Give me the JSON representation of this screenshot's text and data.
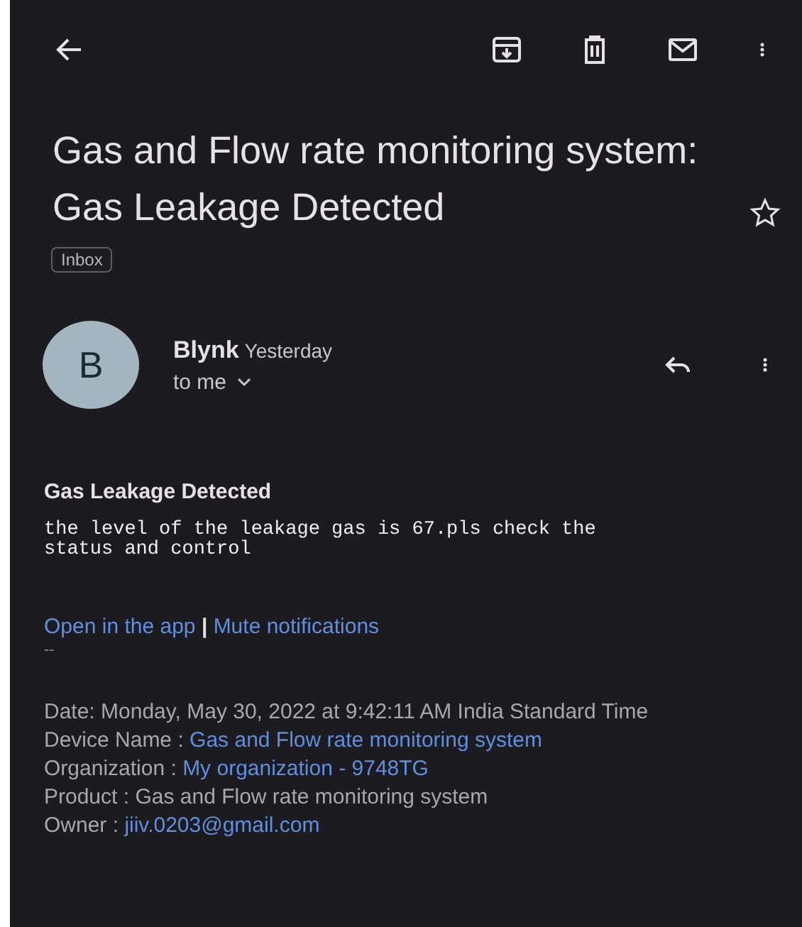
{
  "subject": "Gas and Flow rate monitoring system: Gas Leakage Detected",
  "starred": false,
  "label": "Inbox",
  "sender": {
    "initial": "B",
    "name": "Blynk",
    "time": "Yesterday",
    "recipient": "to me"
  },
  "heading": "Gas Leakage Detected",
  "body": "the level of the leakage gas is 67.pls check the status and control",
  "links": [
    "Open in the app",
    "Mute notifications"
  ],
  "separator": "|",
  "dashes": "--",
  "details": [
    {
      "label": "Date:",
      "value": "Monday, May 30, 2022 at 9:42:11 AM India Standard Time",
      "kind": "plain"
    },
    {
      "label": "Device Name :",
      "value": "Gas and Flow rate monitoring system",
      "kind": "link"
    },
    {
      "label": "Organization :",
      "value": "My organization - 9748TG",
      "kind": "link"
    },
    {
      "label": "Product :",
      "value": "Gas and Flow rate monitoring system",
      "kind": "plain"
    },
    {
      "label": "Owner :",
      "value": "jiiv.0203@gmail.com",
      "kind": "link"
    }
  ]
}
